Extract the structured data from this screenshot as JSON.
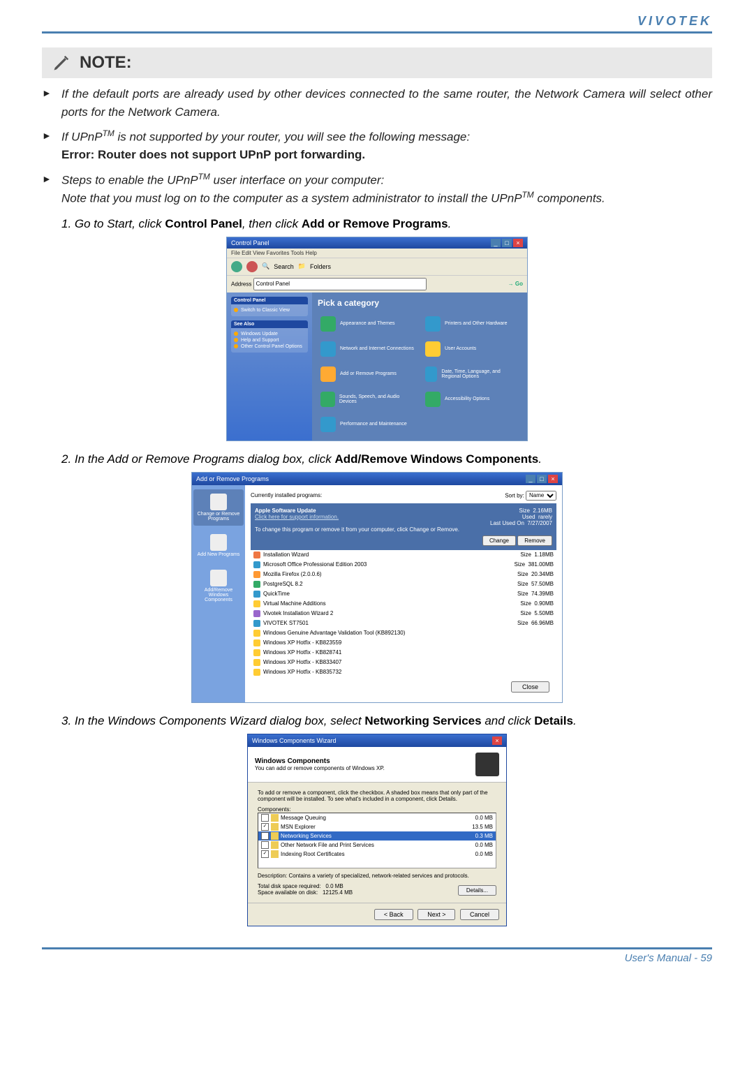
{
  "brand": "VIVOTEK",
  "note_label": "NOTE:",
  "bullet1": "If the default ports are already used by other devices connected to the same router, the Network Camera will select other ports for the Network Camera.",
  "bullet2_a": "If UPnP",
  "bullet2_tm": "TM",
  "bullet2_b": " is not supported by your router, you will see the following message:",
  "bullet2_err": "Error: Router does not support UPnP port forwarding.",
  "bullet3_a": "Steps to enable the UPnP",
  "bullet3_tm": "TM",
  "bullet3_b": " user interface on your computer:",
  "bullet3_note_a": "Note that you must log on to the computer as a system administrator to install the UPnP",
  "bullet3_note_tm": "TM",
  "bullet3_note_b": " components.",
  "step1_a": "1. Go to Start, click ",
  "step1_cp": "Control Panel",
  "step1_b": ", then click ",
  "step1_ar": "Add or Remove Programs",
  "step1_c": ".",
  "step2_a": "2. In the Add or Remove Programs dialog box, click ",
  "step2_b": "Add/Remove Windows Components",
  "step2_c": ".",
  "step3_a": "3. In the Windows Components Wizard dialog box, select ",
  "step3_b": "Networking Services",
  "step3_c": " and click ",
  "step3_d": "Details",
  "step3_e": ".",
  "footer_a": "User's Manual - ",
  "footer_b": "59",
  "fig1": {
    "title": "Control Panel",
    "menu": "File   Edit   View   Favorites   Tools   Help",
    "back": "Back",
    "search": "Search",
    "folders": "Folders",
    "address": "Address",
    "address_val": "Control Panel",
    "go": "Go",
    "sp1_hdr": "Control Panel",
    "sp1_item": "Switch to Classic View",
    "sp2_hdr": "See Also",
    "sp2_items": [
      "Windows Update",
      "Help and Support",
      "Other Control Panel Options"
    ],
    "pick": "Pick a category",
    "cats": [
      "Appearance and Themes",
      "Printers and Other Hardware",
      "Network and Internet Connections",
      "User Accounts",
      "Add or Remove Programs",
      "Date, Time, Language, and Regional Options",
      "Sounds, Speech, and Audio Devices",
      "Accessibility Options",
      "Performance and Maintenance"
    ]
  },
  "fig2": {
    "title": "Add or Remove Programs",
    "left": [
      "Change or Remove Programs",
      "Add New Programs",
      "Add/Remove Windows Components"
    ],
    "hdr": "Currently installed programs:",
    "sortby": "Sort by:",
    "sortval": "Name",
    "sel_name": "Apple Software Update",
    "sel_support": "Click here for support information.",
    "sel_size_l": "Size",
    "sel_size_v": "2.16MB",
    "sel_used_l": "Used",
    "sel_used_v": "rarely",
    "sel_last_l": "Last Used On",
    "sel_last_v": "7/27/2007",
    "sel_instr": "To change this program or remove it from your computer, click Change or Remove.",
    "btn_change": "Change",
    "btn_remove": "Remove",
    "progs": [
      {
        "n": "Installation Wizard",
        "s": "Size",
        "v": "1.18MB"
      },
      {
        "n": "Microsoft Office Professional Edition 2003",
        "s": "Size",
        "v": "381.00MB"
      },
      {
        "n": "Mozilla Firefox (2.0.0.6)",
        "s": "Size",
        "v": "20.34MB"
      },
      {
        "n": "PostgreSQL 8.2",
        "s": "Size",
        "v": "57.50MB"
      },
      {
        "n": "QuickTime",
        "s": "Size",
        "v": "74.39MB"
      },
      {
        "n": "Virtual Machine Additions",
        "s": "Size",
        "v": "0.90MB"
      },
      {
        "n": "Vivotek Installation Wizard 2",
        "s": "Size",
        "v": "5.50MB"
      },
      {
        "n": "VIVOTEK ST7501",
        "s": "Size",
        "v": "66.96MB"
      },
      {
        "n": "Windows Genuine Advantage Validation Tool (KB892130)",
        "s": "",
        "v": ""
      },
      {
        "n": "Windows XP Hotfix - KB823559",
        "s": "",
        "v": ""
      },
      {
        "n": "Windows XP Hotfix - KB828741",
        "s": "",
        "v": ""
      },
      {
        "n": "Windows XP Hotfix - KB833407",
        "s": "",
        "v": ""
      },
      {
        "n": "Windows XP Hotfix - KB835732",
        "s": "",
        "v": ""
      }
    ],
    "close": "Close"
  },
  "fig3": {
    "title": "Windows Components Wizard",
    "hdr_b": "Windows Components",
    "hdr_t": "You can add or remove components of Windows XP.",
    "instr": "To add or remove a component, click the checkbox. A shaded box means that only part of the component will be installed. To see what's included in a component, click Details.",
    "comp_lbl": "Components:",
    "comps": [
      {
        "c": "",
        "n": "Message Queuing",
        "v": "0.0 MB"
      },
      {
        "c": "✓",
        "n": "MSN Explorer",
        "v": "13.5 MB"
      },
      {
        "c": "✓",
        "n": "Networking Services",
        "v": "0.3 MB",
        "sel": true
      },
      {
        "c": "",
        "n": "Other Network File and Print Services",
        "v": "0.0 MB"
      },
      {
        "c": "✓",
        "n": "Indexing Root Certificates",
        "v": "0.0 MB"
      }
    ],
    "desc_l": "Description:",
    "desc_t": "Contains a variety of specialized, network-related services and protocols.",
    "disk_req_l": "Total disk space required:",
    "disk_req_v": "0.0 MB",
    "disk_av_l": "Space available on disk:",
    "disk_av_v": "12125.4 MB",
    "details": "Details...",
    "back": "< Back",
    "next": "Next >",
    "cancel": "Cancel"
  }
}
